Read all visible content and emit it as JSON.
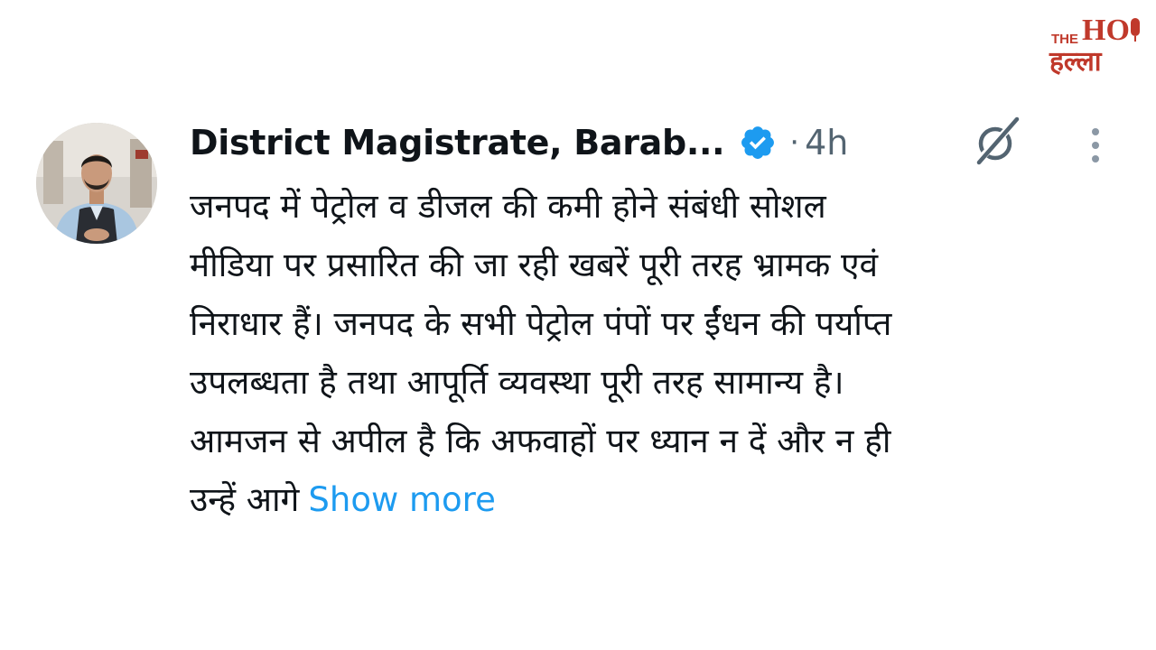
{
  "watermark": {
    "name": "THE HO हल्ला",
    "colors": {
      "red": "#c0392b",
      "dark": "#2b2b2b"
    }
  },
  "tweet": {
    "author": {
      "display_name": "District Magistrate, Barab...",
      "verified": true,
      "avatar_icon": "profile-photo"
    },
    "separator": "·",
    "time": "4h",
    "grok_icon": "grok-icon",
    "more_icon": "more-vertical-icon",
    "lines": [
      "जनपद में पेट्रोल व डीजल की कमी होने संबंधी सोशल",
      "मीडिया पर प्रसारित की जा रही खबरें पूरी तरह भ्रामक एवं",
      "निराधार हैं। जनपद के सभी पेट्रोल पंपों पर ईंधन की पर्याप्त",
      "उपलब्धता है तथा आपूर्ति व्यवस्था पूरी तरह सामान्य है।",
      "आमजन से अपील है कि अफवाहों पर ध्यान न दें और न ही",
      "उन्हें आगे"
    ],
    "show_more": "Show more"
  },
  "colors": {
    "text": "#0f1419",
    "secondary": "#536471",
    "link": "#1d9bf0",
    "verified": "#1d9bf0"
  }
}
